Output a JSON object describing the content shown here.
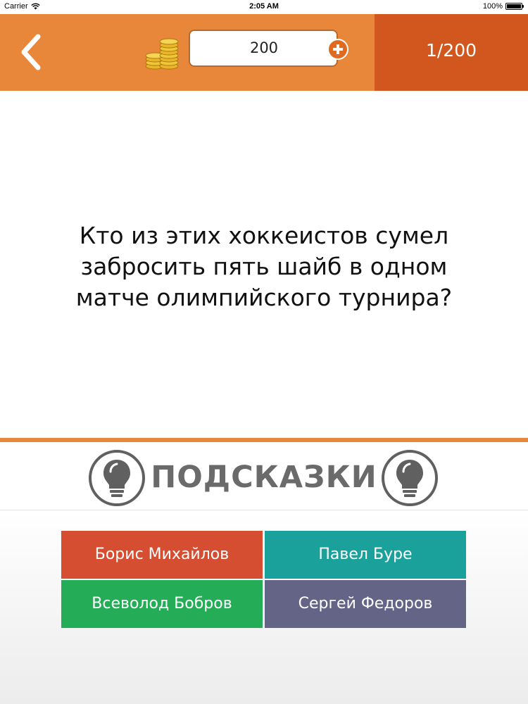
{
  "status_bar": {
    "carrier": "Carrier",
    "wifi_icon": "wifi-icon",
    "time": "2:05 AM",
    "battery": "100%"
  },
  "header": {
    "back_icon": "chevron-left-icon",
    "coins_icon": "coin-stack-icon",
    "coins": "200",
    "add_coins_icon": "plus-circle-icon",
    "progress": "1/200"
  },
  "question": {
    "line1": "Кто из этих хоккеистов сумел",
    "line2": "забросить пять шайб в одном",
    "line3": "матче олимпийского турнира?"
  },
  "hints": {
    "label": "ПОДСКАЗКИ",
    "icon": "lightbulb-icon"
  },
  "answers": [
    {
      "label": "Борис Михайлов",
      "color": "#d54e32"
    },
    {
      "label": "Павел Буре",
      "color": "#1aa19b"
    },
    {
      "label": "Всеволод Бобров",
      "color": "#24ac57"
    },
    {
      "label": "Сергей Федоров",
      "color": "#646486"
    }
  ],
  "colors": {
    "header": "#e8873a",
    "progress_box": "#d2571f",
    "hints_text": "#6a6a6a"
  }
}
